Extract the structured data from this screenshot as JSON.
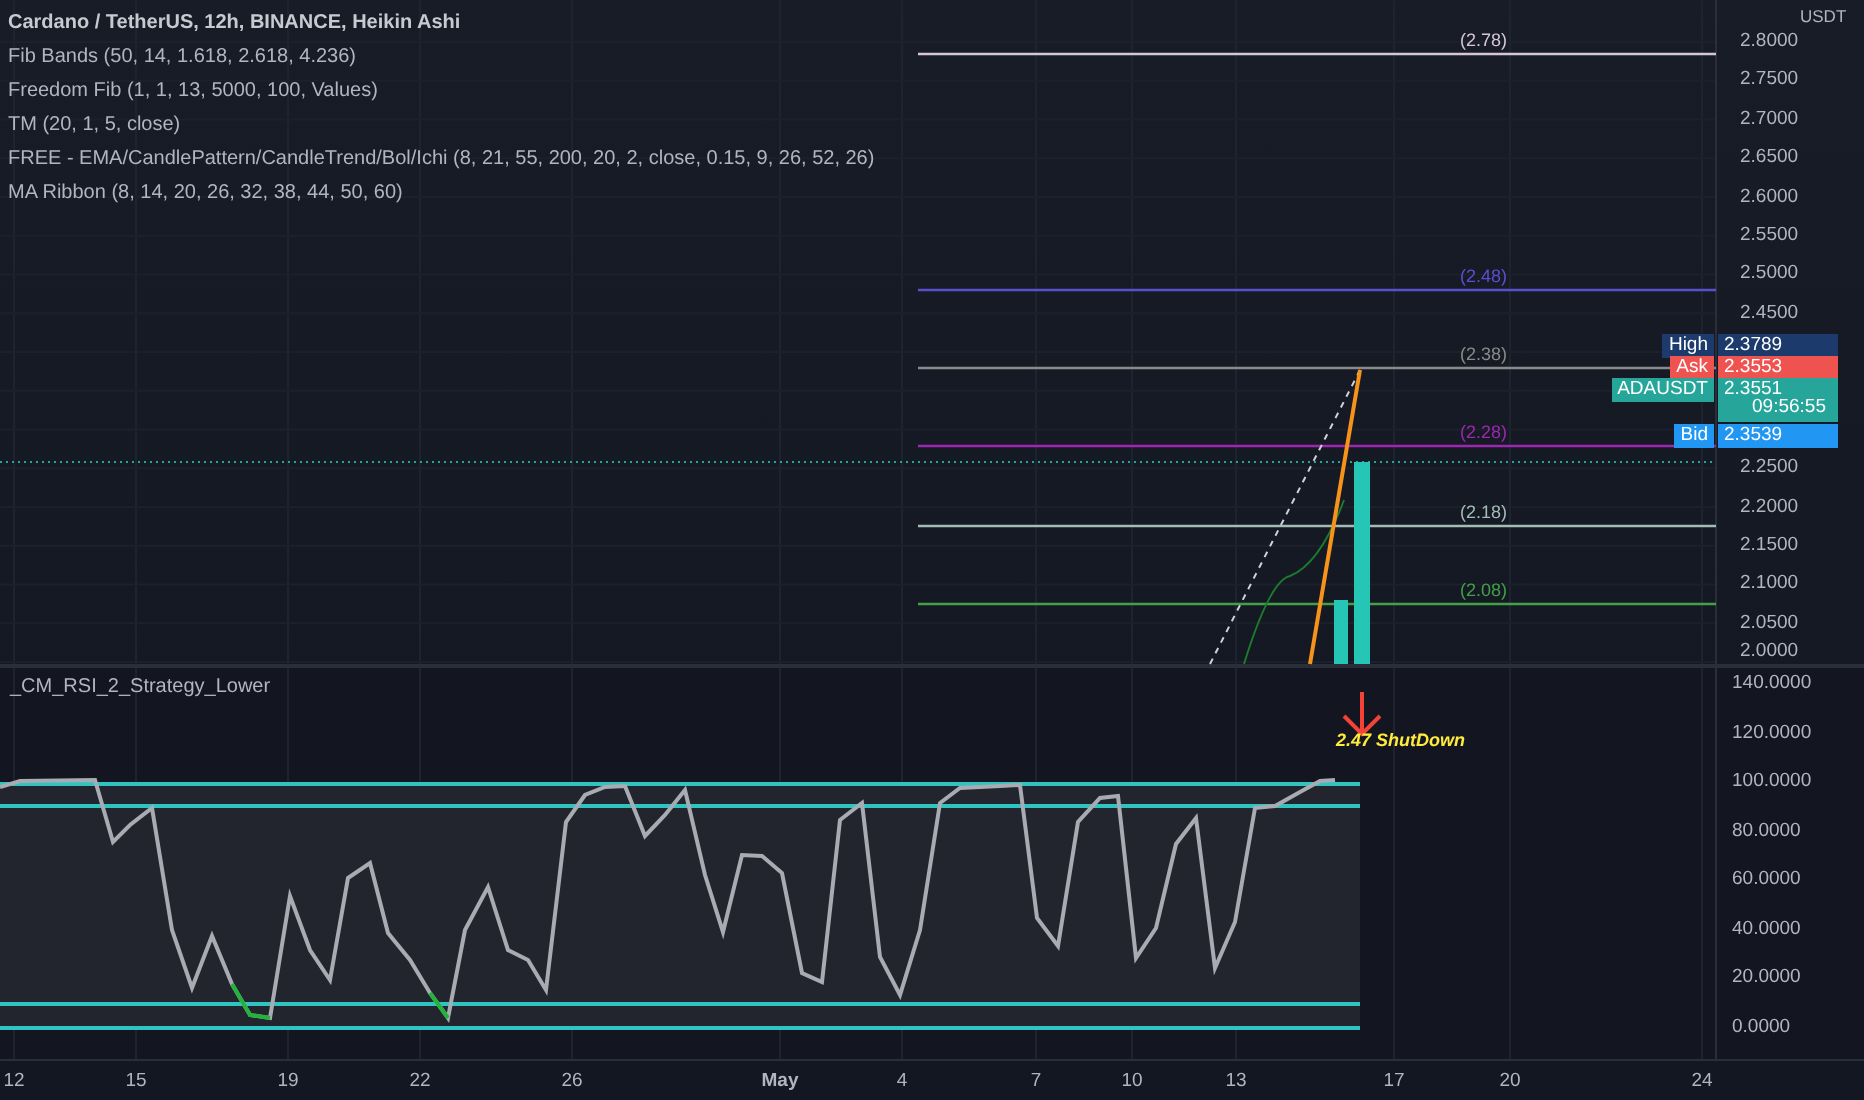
{
  "legend": {
    "title": "Cardano / TetherUS, 12h, BINANCE, Heikin Ashi",
    "indicators": [
      "Fib Bands (50, 14, 1.618, 2.618, 4.236)",
      "Freedom Fib (1, 1, 13, 5000, 100, Values)",
      "TM (20, 1, 5, close)",
      "FREE - EMA/CandlePattern/CandleTrend/Bol/Ichi (8, 21, 55, 200, 20, 2, close, 0.15, 9, 26, 52, 26)",
      "MA Ribbon (8, 14, 20, 26, 32, 38, 44, 50, 60)"
    ]
  },
  "fib_levels": [
    {
      "label": "(2.78)",
      "color": "#d6c6d8"
    },
    {
      "label": "(2.48)",
      "color": "#5a4fcf"
    },
    {
      "label": "(2.38)",
      "color": "#8a8a8a"
    },
    {
      "label": "(2.28)",
      "color": "#9c27b0"
    },
    {
      "label": "(2.18)",
      "color": "#a3bdb5"
    },
    {
      "label": "(2.08)",
      "color": "#43a047"
    }
  ],
  "price_axis": {
    "unit": "USDT",
    "ticks_upper": [
      "2.8000",
      "2.7500",
      "2.7000",
      "2.6500",
      "2.6000",
      "2.5500",
      "2.5000",
      "2.4500"
    ],
    "ticks_lower": [
      "2.2500",
      "2.2000",
      "2.1500",
      "2.1000",
      "2.0500",
      "2.0000"
    ]
  },
  "price_tags": [
    {
      "name": "High",
      "value": "2.3789",
      "color": "#1c3a6b"
    },
    {
      "name": "Ask",
      "value": "2.3553",
      "color": "#ef5350"
    },
    {
      "name": "ADAUSDT",
      "value": "2.3551",
      "countdown": "09:56:55",
      "color": "#26a69a"
    },
    {
      "name": "Bid",
      "value": "2.3539",
      "color": "#2196f3"
    }
  ],
  "rsi_pane": {
    "title": "_CM_RSI_2_Strategy_Lower",
    "annotation": "2.47 ShutDown",
    "ticks": [
      "140.0000",
      "120.0000",
      "100.0000",
      "80.0000",
      "60.0000",
      "40.0000",
      "20.0000",
      "0.0000"
    ]
  },
  "time_axis": [
    "12",
    "15",
    "19",
    "22",
    "26",
    "May",
    "4",
    "7",
    "10",
    "13",
    "17",
    "20",
    "24"
  ]
}
